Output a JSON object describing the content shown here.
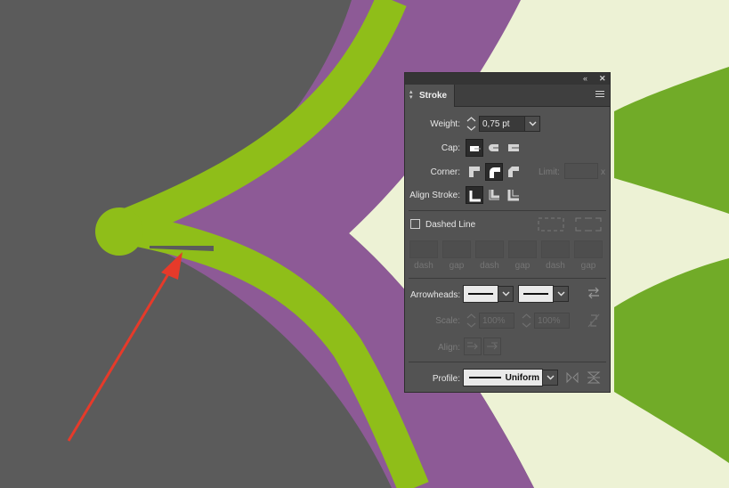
{
  "panel": {
    "tab_title": "Stroke",
    "collapse_icon": "double-chevron-left",
    "close_icon": "close-x",
    "menu_icon": "hamburger-menu"
  },
  "weight": {
    "label": "Weight:",
    "value": "0,75 pt"
  },
  "cap": {
    "label": "Cap:",
    "selected": "butt"
  },
  "corner": {
    "label": "Corner:",
    "selected": "round",
    "limit_label": "Limit:",
    "limit_suffix": "x"
  },
  "align": {
    "label": "Align Stroke:",
    "selected": "center"
  },
  "dashed": {
    "label": "Dashed Line",
    "checked": false,
    "fields": [
      "dash",
      "gap",
      "dash",
      "gap",
      "dash",
      "gap"
    ]
  },
  "arrowheads": {
    "label": "Arrowheads:"
  },
  "scale": {
    "label": "Scale:",
    "start": "100%",
    "end": "100%"
  },
  "align_arrows": {
    "label": "Align:"
  },
  "profile": {
    "label": "Profile:",
    "value": "Uniform"
  },
  "colors": {
    "canvas_bg": "#5b5b5b",
    "green": "#8fbe19",
    "purple": "#8d5a96",
    "cream": "#edf2d5",
    "bright_green": "#71ab28",
    "arrow": "#e63a2a"
  }
}
